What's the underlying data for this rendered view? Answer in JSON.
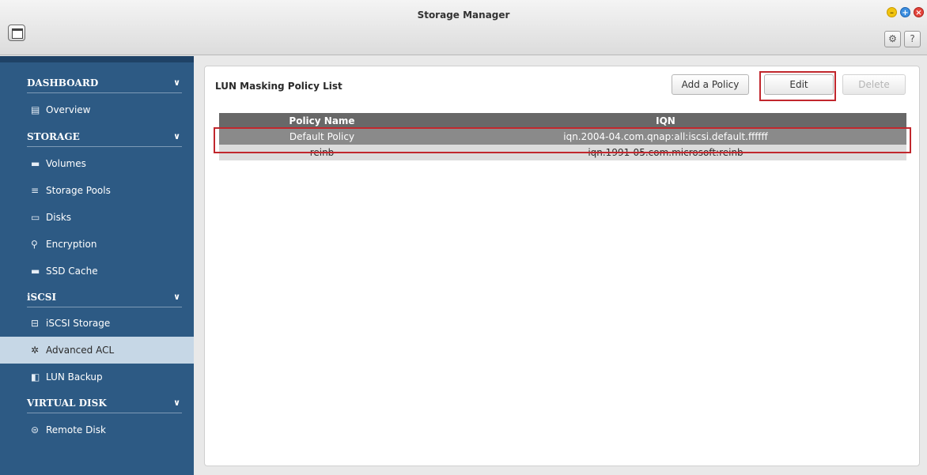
{
  "window": {
    "title": "Storage Manager"
  },
  "sidebar": {
    "categories": [
      {
        "label": "DASHBOARD",
        "items": [
          {
            "label": "Overview",
            "icon": "overview-icon"
          }
        ]
      },
      {
        "label": "STORAGE",
        "items": [
          {
            "label": "Volumes",
            "icon": "volumes-icon"
          },
          {
            "label": "Storage Pools",
            "icon": "storage-pools-icon"
          },
          {
            "label": "Disks",
            "icon": "disks-icon"
          },
          {
            "label": "Encryption",
            "icon": "key-icon"
          },
          {
            "label": "SSD Cache",
            "icon": "ssd-cache-icon"
          }
        ]
      },
      {
        "label": "iSCSI",
        "items": [
          {
            "label": "iSCSI Storage",
            "icon": "iscsi-storage-icon"
          },
          {
            "label": "Advanced ACL",
            "icon": "gear-icon"
          },
          {
            "label": "LUN Backup",
            "icon": "lun-backup-icon"
          }
        ]
      },
      {
        "label": "VIRTUAL DISK",
        "items": [
          {
            "label": "Remote Disk",
            "icon": "remote-disk-icon"
          }
        ]
      }
    ],
    "active_item": "Advanced ACL"
  },
  "main": {
    "title": "LUN Masking Policy List",
    "buttons": {
      "add": "Add a Policy",
      "edit": "Edit",
      "delete": "Delete"
    },
    "table": {
      "columns": [
        "Policy Name",
        "IQN"
      ],
      "rows": [
        {
          "name": "Default Policy",
          "iqn": "iqn.2004-04.com.qnap:all:iscsi.default.ffffff",
          "selected": true
        },
        {
          "name": "reinb",
          "iqn": "iqn.1991-05.com.microsoft:reinb",
          "selected": false
        }
      ]
    }
  },
  "colors": {
    "sidebar_bg": "#2d5a84",
    "active_item_bg": "#c6d7e6",
    "highlight_frame": "#c1272d"
  }
}
